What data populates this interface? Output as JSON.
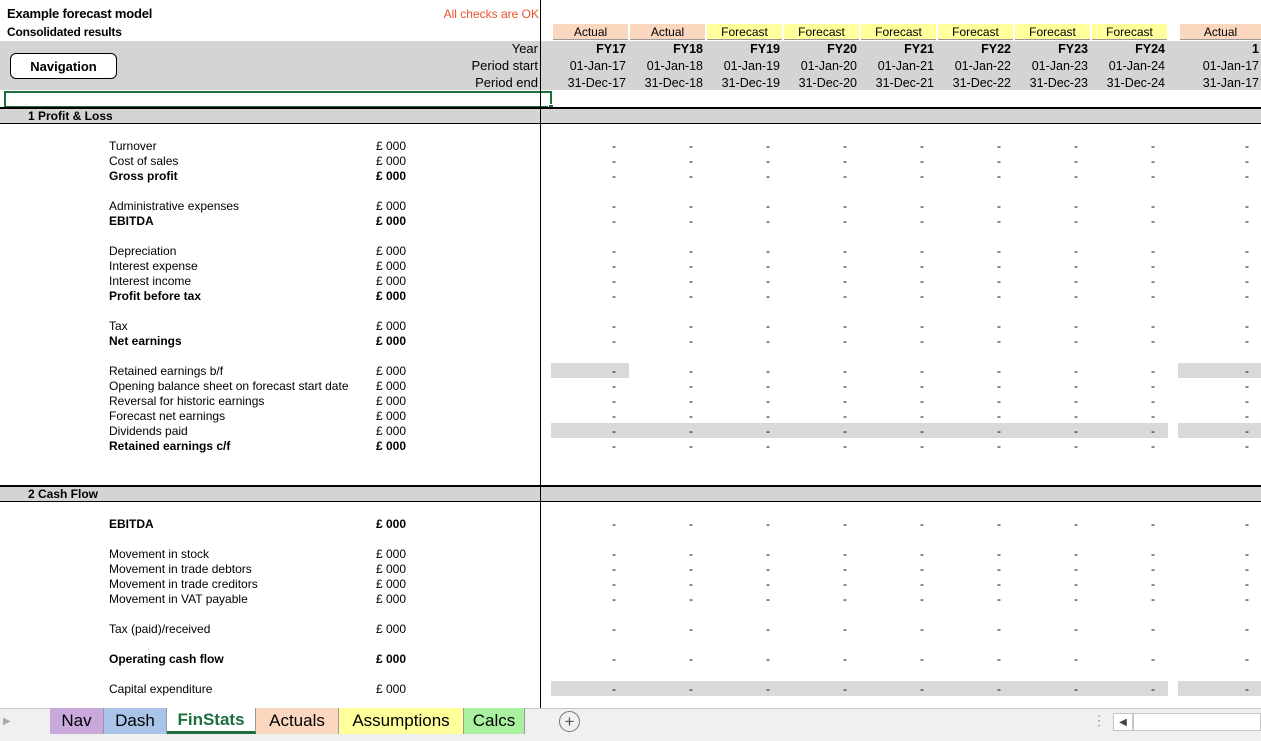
{
  "header": {
    "title": "Example forecast model",
    "subtitle": "Consolidated results",
    "checks": "All checks are OK",
    "nav_button": "Navigation",
    "row_labels": [
      "Year",
      "Period start",
      "Period end"
    ]
  },
  "columns": [
    {
      "type": "Actual",
      "year": "FY17",
      "start": "01-Jan-17",
      "end": "31-Dec-17"
    },
    {
      "type": "Actual",
      "year": "FY18",
      "start": "01-Jan-18",
      "end": "31-Dec-18"
    },
    {
      "type": "Forecast",
      "year": "FY19",
      "start": "01-Jan-19",
      "end": "31-Dec-19"
    },
    {
      "type": "Forecast",
      "year": "FY20",
      "start": "01-Jan-20",
      "end": "31-Dec-20"
    },
    {
      "type": "Forecast",
      "year": "FY21",
      "start": "01-Jan-21",
      "end": "31-Dec-21"
    },
    {
      "type": "Forecast",
      "year": "FY22",
      "start": "01-Jan-22",
      "end": "31-Dec-22"
    },
    {
      "type": "Forecast",
      "year": "FY23",
      "start": "01-Jan-23",
      "end": "31-Dec-23"
    },
    {
      "type": "Forecast",
      "year": "FY24",
      "start": "01-Jan-24",
      "end": "31-Dec-24"
    },
    {
      "type": "Actual",
      "year": "1",
      "start": "01-Jan-17",
      "end": "31-Jan-17"
    }
  ],
  "sections": [
    {
      "label": "1 Profit & Loss",
      "rows": [
        {
          "label": "Turnover",
          "unit": "£ 000",
          "bold": false,
          "shade": false
        },
        {
          "label": "Cost of sales",
          "unit": "£ 000",
          "bold": false,
          "shade": false
        },
        {
          "label": "Gross profit",
          "unit": "£ 000",
          "bold": true,
          "shade": false
        },
        null,
        {
          "label": "Administrative expenses",
          "unit": "£ 000",
          "bold": false,
          "shade": false
        },
        {
          "label": "EBITDA",
          "unit": "£ 000",
          "bold": true,
          "shade": false
        },
        null,
        {
          "label": "Depreciation",
          "unit": "£ 000",
          "bold": false,
          "shade": false
        },
        {
          "label": "Interest expense",
          "unit": "£ 000",
          "bold": false,
          "shade": false
        },
        {
          "label": "Interest income",
          "unit": "£ 000",
          "bold": false,
          "shade": false
        },
        {
          "label": "Profit before tax",
          "unit": "£ 000",
          "bold": true,
          "shade": false
        },
        null,
        {
          "label": "Tax",
          "unit": "£ 000",
          "bold": false,
          "shade": false
        },
        {
          "label": "Net earnings",
          "unit": "£ 000",
          "bold": true,
          "shade": false
        },
        null,
        {
          "label": "Retained earnings b/f",
          "unit": "£ 000",
          "bold": false,
          "shade": "partial"
        },
        {
          "label": "Opening balance sheet on forecast start date",
          "unit": "£ 000",
          "bold": false,
          "shade": false
        },
        {
          "label": "Reversal for historic earnings",
          "unit": "£ 000",
          "bold": false,
          "shade": false
        },
        {
          "label": "Forecast net earnings",
          "unit": "£ 000",
          "bold": false,
          "shade": false
        },
        {
          "label": "Dividends paid",
          "unit": "£ 000",
          "bold": false,
          "shade": "full"
        },
        {
          "label": "Retained earnings c/f",
          "unit": "£ 000",
          "bold": true,
          "shade": false
        }
      ]
    },
    {
      "label": "2 Cash Flow",
      "rows": [
        {
          "label": "EBITDA",
          "unit": "£ 000",
          "bold": true,
          "unit_bold": true,
          "shade": false
        },
        null,
        {
          "label": "Movement in stock",
          "unit": "£ 000",
          "bold": false,
          "shade": false
        },
        {
          "label": "Movement in trade debtors",
          "unit": "£ 000",
          "bold": false,
          "shade": false
        },
        {
          "label": "Movement in trade creditors",
          "unit": "£ 000",
          "bold": false,
          "shade": false
        },
        {
          "label": "Movement in VAT payable",
          "unit": "£ 000",
          "bold": false,
          "shade": false
        },
        null,
        {
          "label": "Tax (paid)/received",
          "unit": "£ 000",
          "bold": false,
          "shade": false
        },
        null,
        {
          "label": "Operating cash flow",
          "unit": "£ 000",
          "bold": true,
          "unit_bold": true,
          "shade": false
        },
        null,
        {
          "label": "Capital expenditure",
          "unit": "£ 000",
          "bold": false,
          "shade": "full"
        }
      ]
    }
  ],
  "cell_value": "-",
  "tabs": [
    {
      "label": "Nav",
      "color": "#c9a9dc"
    },
    {
      "label": "Dash",
      "color": "#a9c4e8"
    },
    {
      "label": "FinStats",
      "color": "#ffffff",
      "active": true
    },
    {
      "label": "Actuals",
      "color": "#fbd7c0"
    },
    {
      "label": "Assumptions",
      "color": "#ffff9c"
    },
    {
      "label": "Calcs",
      "color": "#a9f0a0"
    }
  ],
  "colors": {
    "actual": "#fbd7c0",
    "forecast": "#ffff9c",
    "header_gray": "#d4d4d4",
    "selection": "#1e6e3e",
    "checks_ok": "#e8542a"
  }
}
